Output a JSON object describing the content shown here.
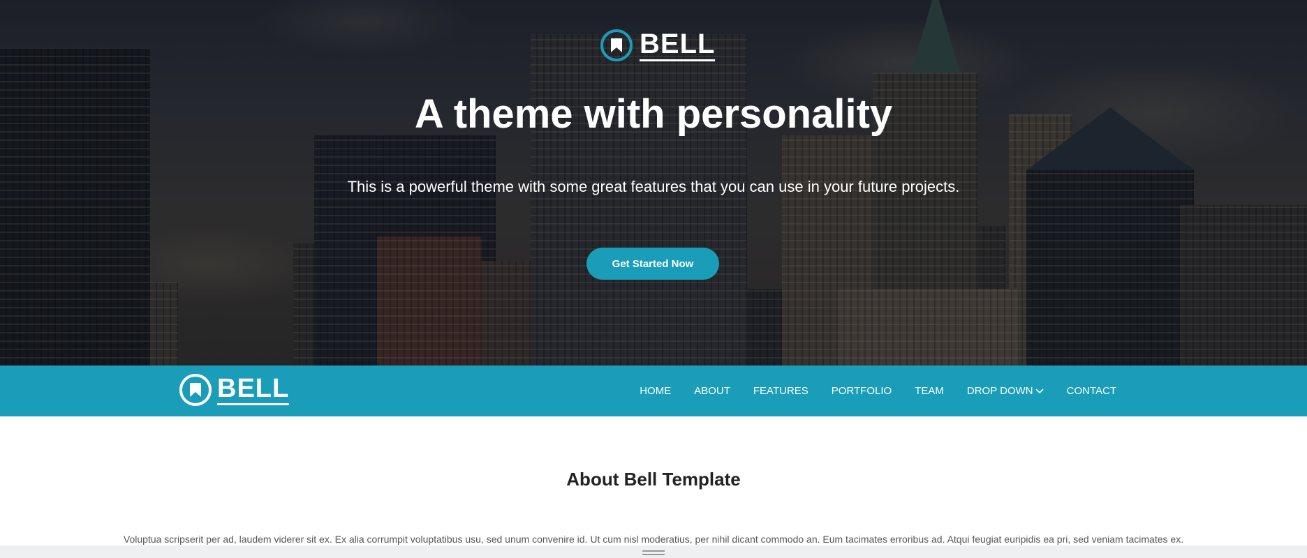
{
  "hero": {
    "logo_text": "BELL",
    "title": "A theme with personality",
    "subtitle": "This is a powerful theme with some great features that you can use in your future projects.",
    "cta_label": "Get Started Now"
  },
  "navbar": {
    "logo_text": "BELL",
    "items": [
      {
        "label": "HOME"
      },
      {
        "label": "ABOUT"
      },
      {
        "label": "FEATURES"
      },
      {
        "label": "PORTFOLIO"
      },
      {
        "label": "TEAM"
      },
      {
        "label": "DROP DOWN"
      },
      {
        "label": "CONTACT"
      }
    ]
  },
  "about": {
    "title": "About Bell Template",
    "text": "Voluptua scripserit per ad, laudem viderer sit ex. Ex alia corrumpit voluptatibus usu, sed unum convenire id. Ut cum nisl moderatius, per nihil dicant commodo an. Eum tacimates erroribus ad. Atqui feugiat euripidis ea pri, sed veniam tacimates ex."
  },
  "colors": {
    "accent": "#1a9db8",
    "text_dark": "#222222",
    "white": "#ffffff"
  },
  "icons": {
    "logo": "bookmark-icon",
    "dropdown": "chevron-down-icon",
    "page_handle": "drag-handle-icon"
  }
}
